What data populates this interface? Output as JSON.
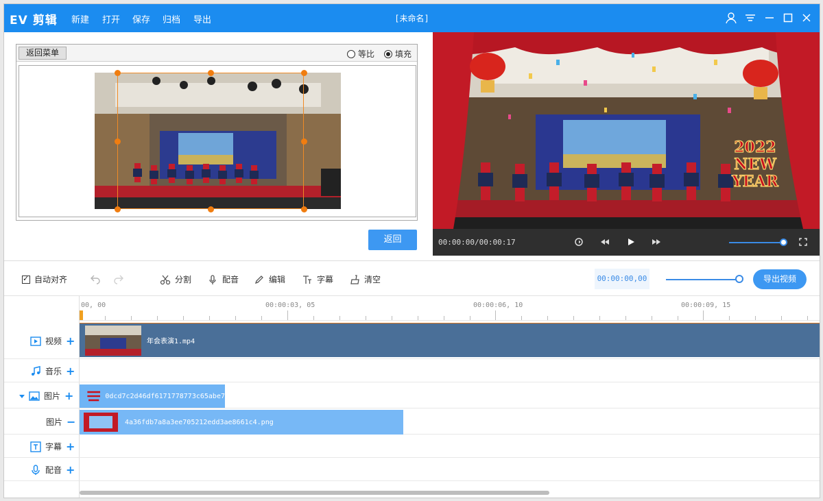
{
  "app": {
    "logo": "EV 剪辑",
    "menu": [
      "新建",
      "打开",
      "保存",
      "归档",
      "导出"
    ],
    "window_title": "[未命名]",
    "icons": [
      "user-icon",
      "skin-icon",
      "minimize-icon",
      "maximize-icon",
      "close-icon"
    ]
  },
  "crop": {
    "back_menu": "返回菜单",
    "ratio_option": "等比",
    "fill_option": "填充",
    "selected": "填充",
    "return_button": "返回"
  },
  "player": {
    "time": "00:00:00/00:00:17",
    "overlay_line1": "2022",
    "overlay_line2": "NEW",
    "overlay_line3": "YEAR",
    "volume_level": 0.95
  },
  "toolbar": {
    "auto_align": "自动对齐",
    "split": "分割",
    "dub": "配音",
    "edit": "编辑",
    "subtitle": "字幕",
    "clear": "清空",
    "timecode": "00:00:00,00",
    "zoom_level": 0.95,
    "export": "导出视频"
  },
  "timeline": {
    "ruler": [
      "00, 00",
      "00:00:03, 05",
      "00:00:06, 10",
      "00:00:09, 15"
    ],
    "tracks": {
      "video": "视频",
      "music": "音乐",
      "image": "图片",
      "image2": "图片",
      "subtitle": "字幕",
      "dub": "配音"
    },
    "clips": {
      "video": "年会表演1.mp4",
      "image1": "0dcd7c2d46df6171778773c65abe7",
      "image2": "4a36fdb7a8a3ee705212edd3ae8661c4.png"
    }
  },
  "colors": {
    "accent": "#1b8cf0",
    "clip_video": "#4a6f98",
    "clip_image": "#6fb4f5"
  }
}
